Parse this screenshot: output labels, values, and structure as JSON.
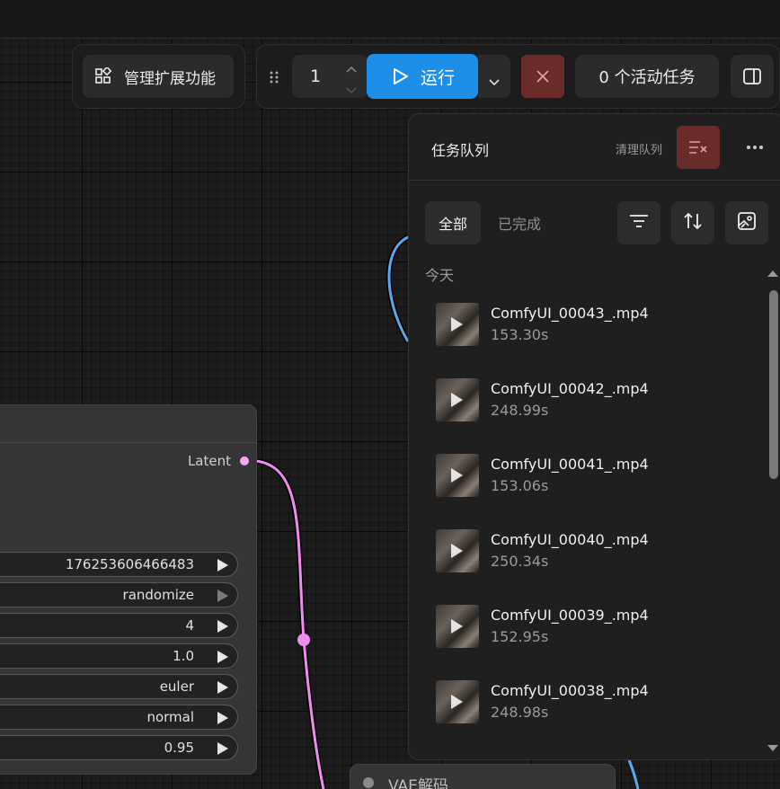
{
  "toolbar": {
    "extensions_label": "管理扩展功能",
    "batch_count": "1",
    "run_label": "运行",
    "active_tasks_label": "0 个活动任务"
  },
  "node": {
    "output_label": "Latent",
    "widgets": [
      {
        "value": "176253606466483",
        "arrow_dim": false
      },
      {
        "value": "randomize",
        "arrow_dim": true
      },
      {
        "value": "4",
        "arrow_dim": false
      },
      {
        "value": "1.0",
        "arrow_dim": false
      },
      {
        "value": "euler",
        "arrow_dim": false
      },
      {
        "value": "normal",
        "arrow_dim": false
      },
      {
        "value": "0.95",
        "arrow_dim": false
      }
    ]
  },
  "queue": {
    "title": "任务队列",
    "clear_label": "清理队列",
    "tabs": [
      {
        "label": "全部",
        "active": true
      },
      {
        "label": "已完成",
        "active": false
      }
    ],
    "section": "今天",
    "items": [
      {
        "name": "ComfyUI_00043_.mp4",
        "time": "153.30s"
      },
      {
        "name": "ComfyUI_00042_.mp4",
        "time": "248.99s"
      },
      {
        "name": "ComfyUI_00041_.mp4",
        "time": "153.06s"
      },
      {
        "name": "ComfyUI_00040_.mp4",
        "time": "250.34s"
      },
      {
        "name": "ComfyUI_00039_.mp4",
        "time": "152.95s"
      },
      {
        "name": "ComfyUI_00038_.mp4",
        "time": "248.98s"
      }
    ]
  },
  "vae_node": {
    "title": "VAE解码"
  },
  "colors": {
    "accent_blue": "#1d8fe8",
    "danger_red": "#6a2b2b",
    "wire_pink": "#f08cf0",
    "wire_blue": "#5aa8ec"
  }
}
